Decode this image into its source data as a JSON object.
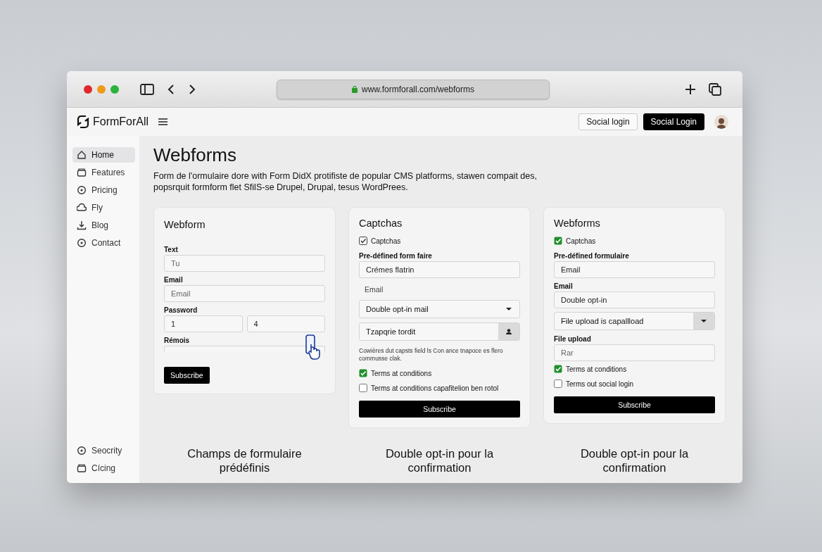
{
  "browser": {
    "url": "www.formforall.com/webforms"
  },
  "header": {
    "logo": "FormForAll",
    "buttons": [
      {
        "label": "Social login",
        "kind": "outline"
      },
      {
        "label": "Social Login",
        "kind": "solid"
      }
    ]
  },
  "sidebar": {
    "items": [
      {
        "label": "Home",
        "kind": "home",
        "selected": true
      },
      {
        "label": "Features",
        "kind": "box",
        "selected": false
      },
      {
        "label": "Pricing",
        "kind": "circle",
        "selected": false
      },
      {
        "label": "Fly",
        "kind": "cloud",
        "selected": false
      },
      {
        "label": "Blog",
        "kind": "download",
        "selected": false
      },
      {
        "label": "Contact",
        "kind": "circle",
        "selected": false
      }
    ],
    "bottom_items": [
      {
        "label": "Seocrity",
        "kind": "circle",
        "selected": false
      },
      {
        "label": "Cícing",
        "kind": "box",
        "selected": false
      }
    ]
  },
  "page": {
    "title": "Webforms",
    "description": "Form de l'ormulaire dore with Form DidX protifiste de popular CMS platforms, stawen compait des, popsrquit formform flet SfilS-se Drupel, Drupal, tesus WordPrees."
  },
  "cards": [
    {
      "title": "Webform",
      "items": [
        {
          "kind": "label",
          "text": "Text"
        },
        {
          "kind": "input",
          "placeholder": "Tu"
        },
        {
          "kind": "label",
          "text": "Email"
        },
        {
          "kind": "input",
          "placeholder": "Email"
        },
        {
          "kind": "label",
          "text": "Password"
        },
        {
          "kind": "pair",
          "values": [
            "1",
            "4"
          ]
        },
        {
          "kind": "label",
          "text": "Rémois"
        },
        {
          "kind": "partial"
        },
        {
          "kind": "button",
          "text": "Subscribe"
        }
      ]
    },
    {
      "title": "Captchas",
      "items": [
        {
          "kind": "tickbox",
          "text": "Captchas",
          "checked": true
        },
        {
          "kind": "label",
          "text": "Pre-défined form faire"
        },
        {
          "kind": "input",
          "value": "Crémes flatrin"
        },
        {
          "kind": "sublabel",
          "text": "Email"
        },
        {
          "kind": "select",
          "value": "Double opt-in mail"
        },
        {
          "kind": "action",
          "value": "Tzapqrie tordit"
        },
        {
          "kind": "note",
          "text": "Cowières dut capsts field ls Con ance tnapoce es flero commusse clak."
        },
        {
          "kind": "checkbox",
          "text": "Terms at conditions",
          "checked": true
        },
        {
          "kind": "checkbox",
          "text": "Terms at conditions capafitelion ben rotol",
          "checked": false
        },
        {
          "kind": "widebutton",
          "text": "Subscribe"
        }
      ]
    },
    {
      "title": "Webforms",
      "items": [
        {
          "kind": "checkbox",
          "text": "Captchas",
          "checked": true
        },
        {
          "kind": "label",
          "text": "Pre-défined formulaire"
        },
        {
          "kind": "input",
          "value": "Email"
        },
        {
          "kind": "label",
          "text": "Email"
        },
        {
          "kind": "input",
          "value": "Double opt-in"
        },
        {
          "kind": "boxselect",
          "value": "File upload is capallload"
        },
        {
          "kind": "label",
          "text": "File upload"
        },
        {
          "kind": "input",
          "placeholder": "Rar"
        },
        {
          "kind": "checkbox",
          "text": "Terms at conditions",
          "checked": true
        },
        {
          "kind": "checkbox",
          "text": "Terms out social login",
          "checked": false
        },
        {
          "kind": "widebutton",
          "text": "Subscribe"
        }
      ]
    }
  ],
  "features": [
    {
      "title": "Champs de formulaire prédéfinis"
    },
    {
      "title": "Double opt-in pour la confirmation"
    },
    {
      "title": "Double opt-in pour la confirmation"
    }
  ]
}
